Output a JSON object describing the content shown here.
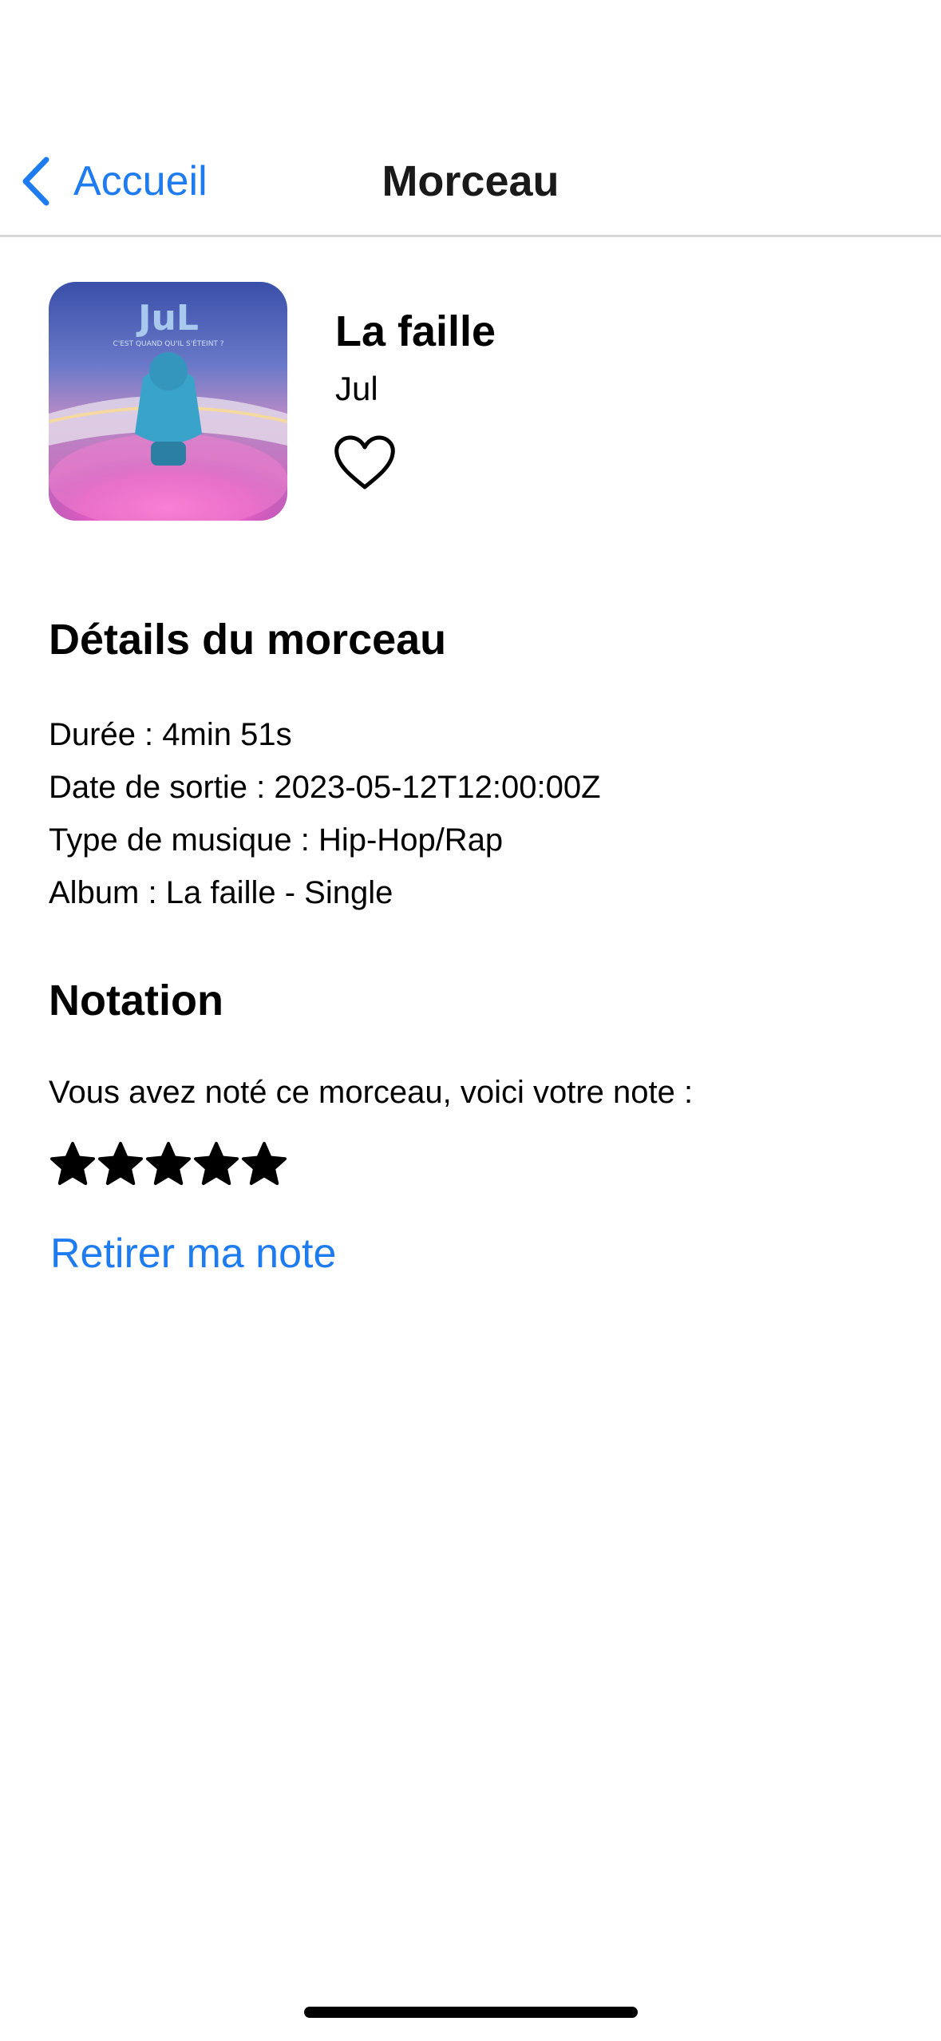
{
  "nav": {
    "back_label": "Accueil",
    "title": "Morceau"
  },
  "track": {
    "title": "La faille",
    "artist": "Jul",
    "favorite": false,
    "artwork_icon": "album-cover-jul"
  },
  "details": {
    "heading": "Détails du morceau",
    "lines": [
      "Durée : 4min 51s",
      "Date de sortie : 2023-05-12T12:00:00Z",
      "Type de musique : Hip-Hop/Rap",
      "Album : La faille - Single"
    ]
  },
  "rating": {
    "heading": "Notation",
    "prompt": "Vous avez noté ce morceau, voici votre note :",
    "value": 5,
    "max": 5,
    "remove_label": "Retirer ma note"
  },
  "colors": {
    "accent": "#1e7cf0",
    "divider": "#d6d6d8"
  }
}
